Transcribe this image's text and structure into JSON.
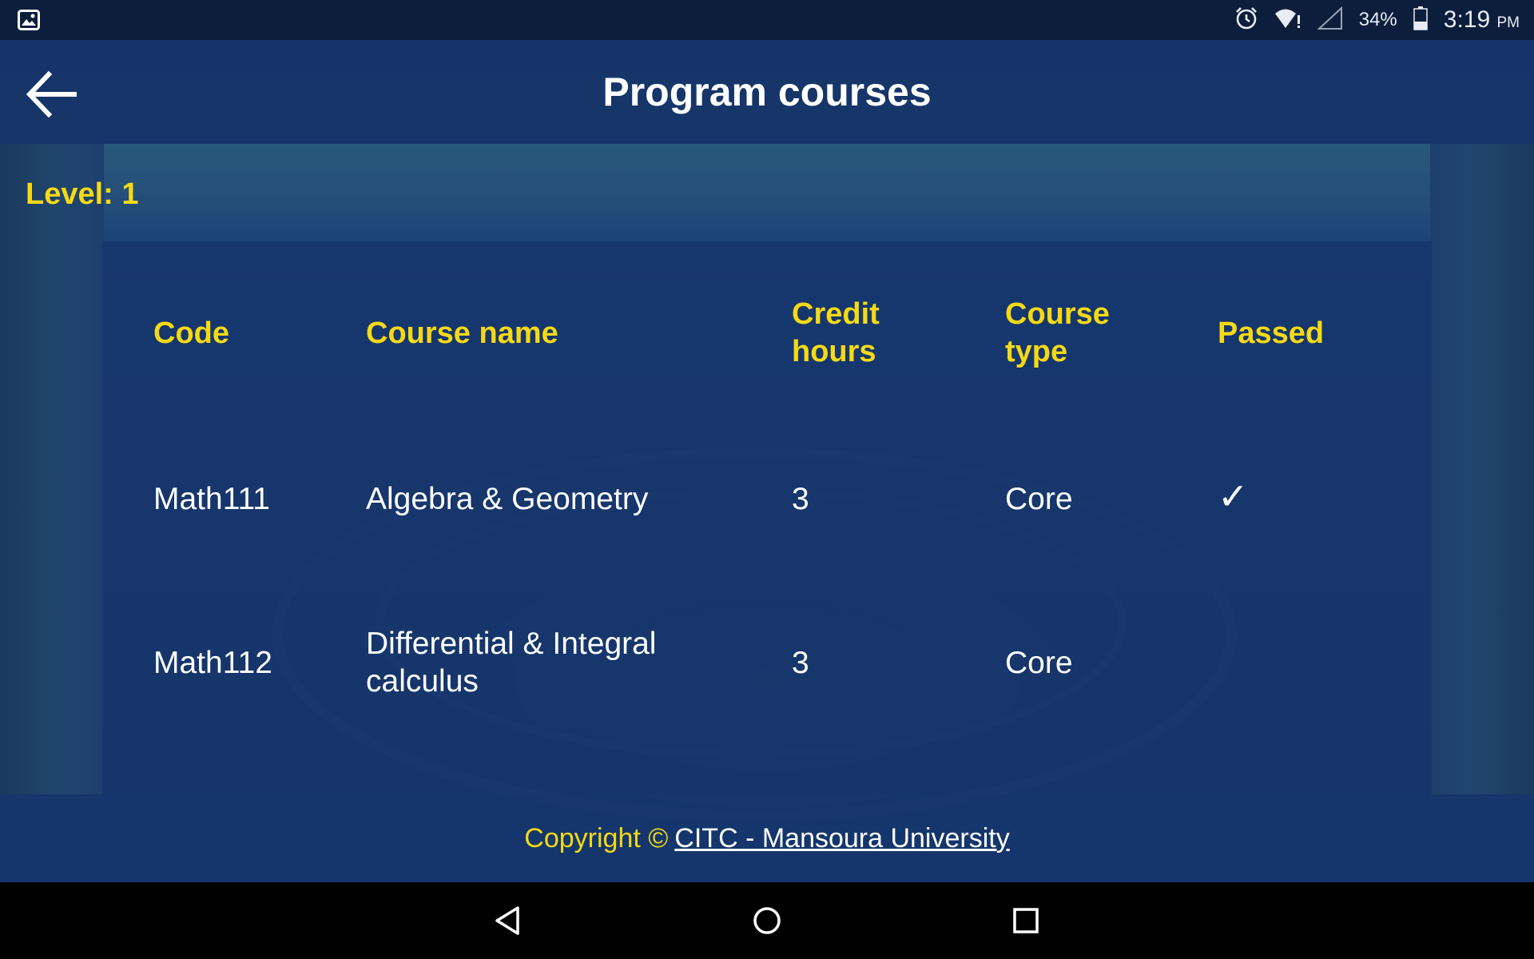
{
  "status_bar": {
    "icons": [
      "image-icon",
      "alarm-icon",
      "wifi-icon",
      "signal-icon",
      "battery-icon"
    ],
    "battery": "34%",
    "time": "3:19",
    "meridiem": "PM"
  },
  "app_bar": {
    "title": "Program courses",
    "back_icon": "arrow-left-icon"
  },
  "level": "Level: 1",
  "table": {
    "headers": {
      "code": "Code",
      "name": "Course name",
      "credit_line1": "Credit",
      "credit_line2": "hours",
      "type_line1": "Course",
      "type_line2": "type",
      "passed": "Passed"
    },
    "rows": [
      {
        "code": "Math111",
        "name": "Algebra & Geometry",
        "credit": "3",
        "type": "Core",
        "passed": "✓"
      },
      {
        "code": "Math112",
        "name": "Differential & Integral calculus",
        "credit": "3",
        "type": "Core",
        "passed": ""
      }
    ]
  },
  "footer": {
    "copyright": "Copyright ©",
    "link": "CITC - Mansoura University"
  },
  "nav": {
    "back": "triangle-back-icon",
    "home": "circle-home-icon",
    "recents": "square-recents-icon"
  },
  "colors": {
    "accent": "#f5d915",
    "bar": "#163468",
    "status_bar": "#0c1e3c"
  }
}
